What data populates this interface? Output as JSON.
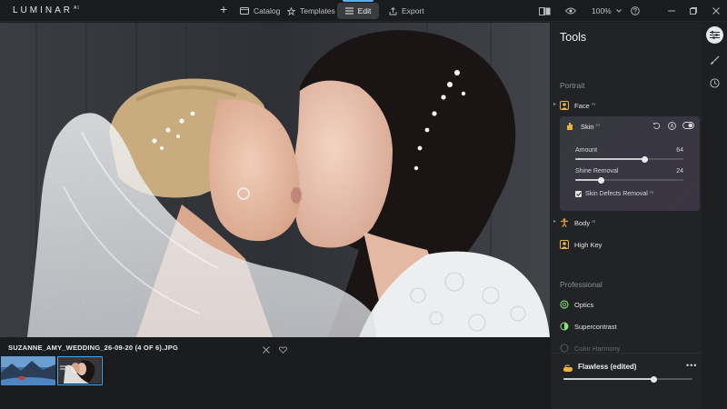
{
  "app": {
    "logo": "LUMINAR",
    "logo_sup": "AI"
  },
  "nav": {
    "plus": "+",
    "catalog": "Catalog",
    "templates": "Templates",
    "edit": "Edit",
    "export": "Export",
    "active": "Edit"
  },
  "toolbar": {
    "zoom": "100%"
  },
  "photo": {
    "filename": "SUZANNE_AMY_WEDDING_26-09-20 (4 OF 6).JPG"
  },
  "filmstrip": {
    "thumb_count": 2,
    "selected_index": 1
  },
  "panel": {
    "title": "Tools",
    "section_portrait": "Portrait",
    "section_professional": "Professional",
    "ai_badge": "AI",
    "face_label": "Face",
    "skin": {
      "label": "Skin",
      "amount_label": "Amount",
      "amount_value": "64",
      "amount_fraction": 0.64,
      "shine_label": "Shine Removal",
      "shine_value": "24",
      "shine_fraction": 0.24,
      "defects_label": "Skin Defects Removal",
      "defects_checked": true,
      "enabled": true
    },
    "body_label": "Body",
    "highkey_label": "High Key",
    "optics_label": "Optics",
    "supercontrast_label": "Supercontrast",
    "colorharmony_label": "Color Harmony"
  },
  "preset": {
    "name": "Flawless (edited)",
    "more": "•••",
    "fraction": 0.7
  },
  "colors": {
    "accent": "#4aa8e8",
    "face_icon": "#e8b43c",
    "body_icon": "#e89a3c",
    "optics": "#7fd36b",
    "supercontrast": "#8ee07a"
  }
}
